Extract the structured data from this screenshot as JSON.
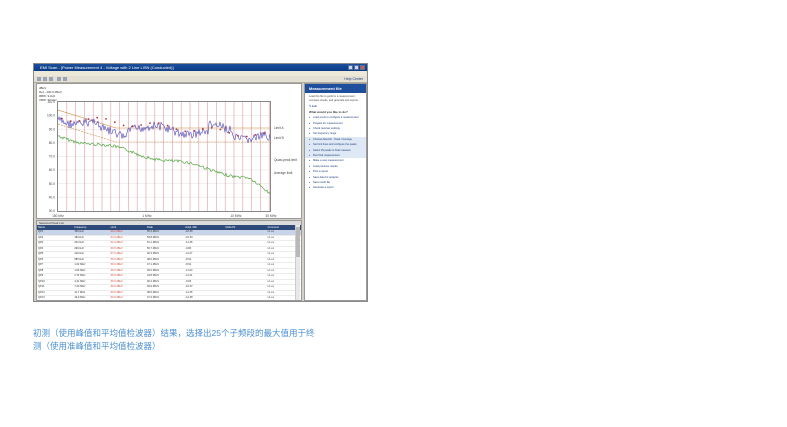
{
  "window": {
    "title": "EMI Scan - [Power Measurement 4 - Voltage with 2 Line LISN (Conducted)]",
    "menu": [
      "File",
      "View",
      "Scan",
      "Window",
      "Analyze",
      "Help"
    ],
    "help_label": "Help Center"
  },
  "chart": {
    "header_lines": [
      "dBuV",
      "Ref: -100.0 dBuV",
      "RBW: 9 kHz",
      "VBW: 30 kHz"
    ],
    "y_ticks": [
      "110.0",
      "100.0",
      "90.0",
      "80.0",
      "70.0",
      "60.0",
      "50.0",
      "40.0",
      "30.0"
    ],
    "x_ticks": [
      "150 kHz",
      "1 MHz",
      "10 MHz",
      "30 MHz"
    ],
    "right_labels": [
      "Limit A",
      "Limit B",
      "Quasi-peak limit",
      "Average limit"
    ]
  },
  "table": {
    "title": "Selected Peak List",
    "headers": [
      "Name",
      "Frequency",
      "Limit",
      "Peak",
      "Ampl. Mkr",
      "Delta Pk",
      "Comment"
    ],
    "rows": [
      [
        "QP1",
        "150 kHz",
        "66.0 dBuV",
        "55.3 dBuV",
        "-10.66",
        "",
        "L1 ex"
      ],
      [
        "QP2",
        "183 kHz",
        "64.3 dBuV",
        "53.8 dBuV",
        "-10.53",
        "",
        "L1 ex"
      ],
      [
        "QP3",
        "232 kHz",
        "62.4 dBuV",
        "51.1 dBuV",
        "-11.35",
        "",
        "L1 ex"
      ],
      [
        "QP4",
        "290 kHz",
        "60.5 dBuV",
        "50.7 dBuV",
        "-9.80",
        "",
        "L1 ex"
      ],
      [
        "QP5",
        "410 kHz",
        "57.6 dBuV",
        "46.3 dBuV",
        "-11.27",
        "",
        "L1 ex"
      ],
      [
        "QP6",
        "585 kHz",
        "56.0 dBuV",
        "48.0 dBuV",
        "-8.02",
        "",
        "L1 ex"
      ],
      [
        "QP7",
        "1.02 MHz",
        "56.0 dBuV",
        "47.1 dBuV",
        "-8.91",
        "",
        "L1 ex"
      ],
      [
        "QP8",
        "1.66 MHz",
        "56.0 dBuV",
        "45.0 dBuV",
        "-11.04",
        "",
        "L1 ex"
      ],
      [
        "QP9",
        "2.74 MHz",
        "56.0 dBuV",
        "44.8 dBuV",
        "-11.21",
        "",
        "L1 ex"
      ],
      [
        "QP10",
        "4.41 MHz",
        "56.0 dBuV",
        "46.4 dBuV",
        "-9.63",
        "",
        "L1 ex"
      ],
      [
        "QP11",
        "7.20 MHz",
        "60.0 dBuV",
        "49.9 dBuV",
        "-10.07",
        "",
        "L1 ex"
      ],
      [
        "QP12",
        "11.7 MHz",
        "60.0 dBuV",
        "48.6 dBuV",
        "-11.35",
        "",
        "L1 ex"
      ],
      [
        "QP13",
        "19.0 MHz",
        "60.0 dBuV",
        "47.3 dBuV",
        "-12.68",
        "",
        "L1 ex"
      ],
      [
        "QP14",
        "26.1 MHz",
        "60.0 dBuV",
        "46.2 dBuV",
        "-13.79",
        "",
        "L1 ex"
      ]
    ]
  },
  "side": {
    "title": "Measurement file",
    "intro": "Load this file to perform a measurement, compare results, and generate test reports.",
    "edit_link": "Edit",
    "question": "What would you like to do?",
    "steps": [
      "Load a test to configure a measurement",
      "Prepare for measurement",
      "Check receiver settings",
      "Set frequency range",
      "Choose detector - Peak / Average",
      "Set limit lines and configure the peaks",
      "Select 25 peaks to final measure",
      "Run final measurement",
      "Make a new measurement",
      "Load previous results",
      "Print a report",
      "Save data for analysis",
      "Save result file",
      "Generate a report"
    ]
  },
  "caption": {
    "line1": "初测（使用峰值和平均值检波器）结果，选择出25个子频段的最大值用于终",
    "line2": "测（使用准峰值和平均值检波器）"
  },
  "colors": {
    "peak_trace": "#4a46b8",
    "average_trace": "#55a845",
    "limit_line": "#c98a3a",
    "grid_v": "#e59aa0",
    "caption": "#4a8fd0"
  }
}
